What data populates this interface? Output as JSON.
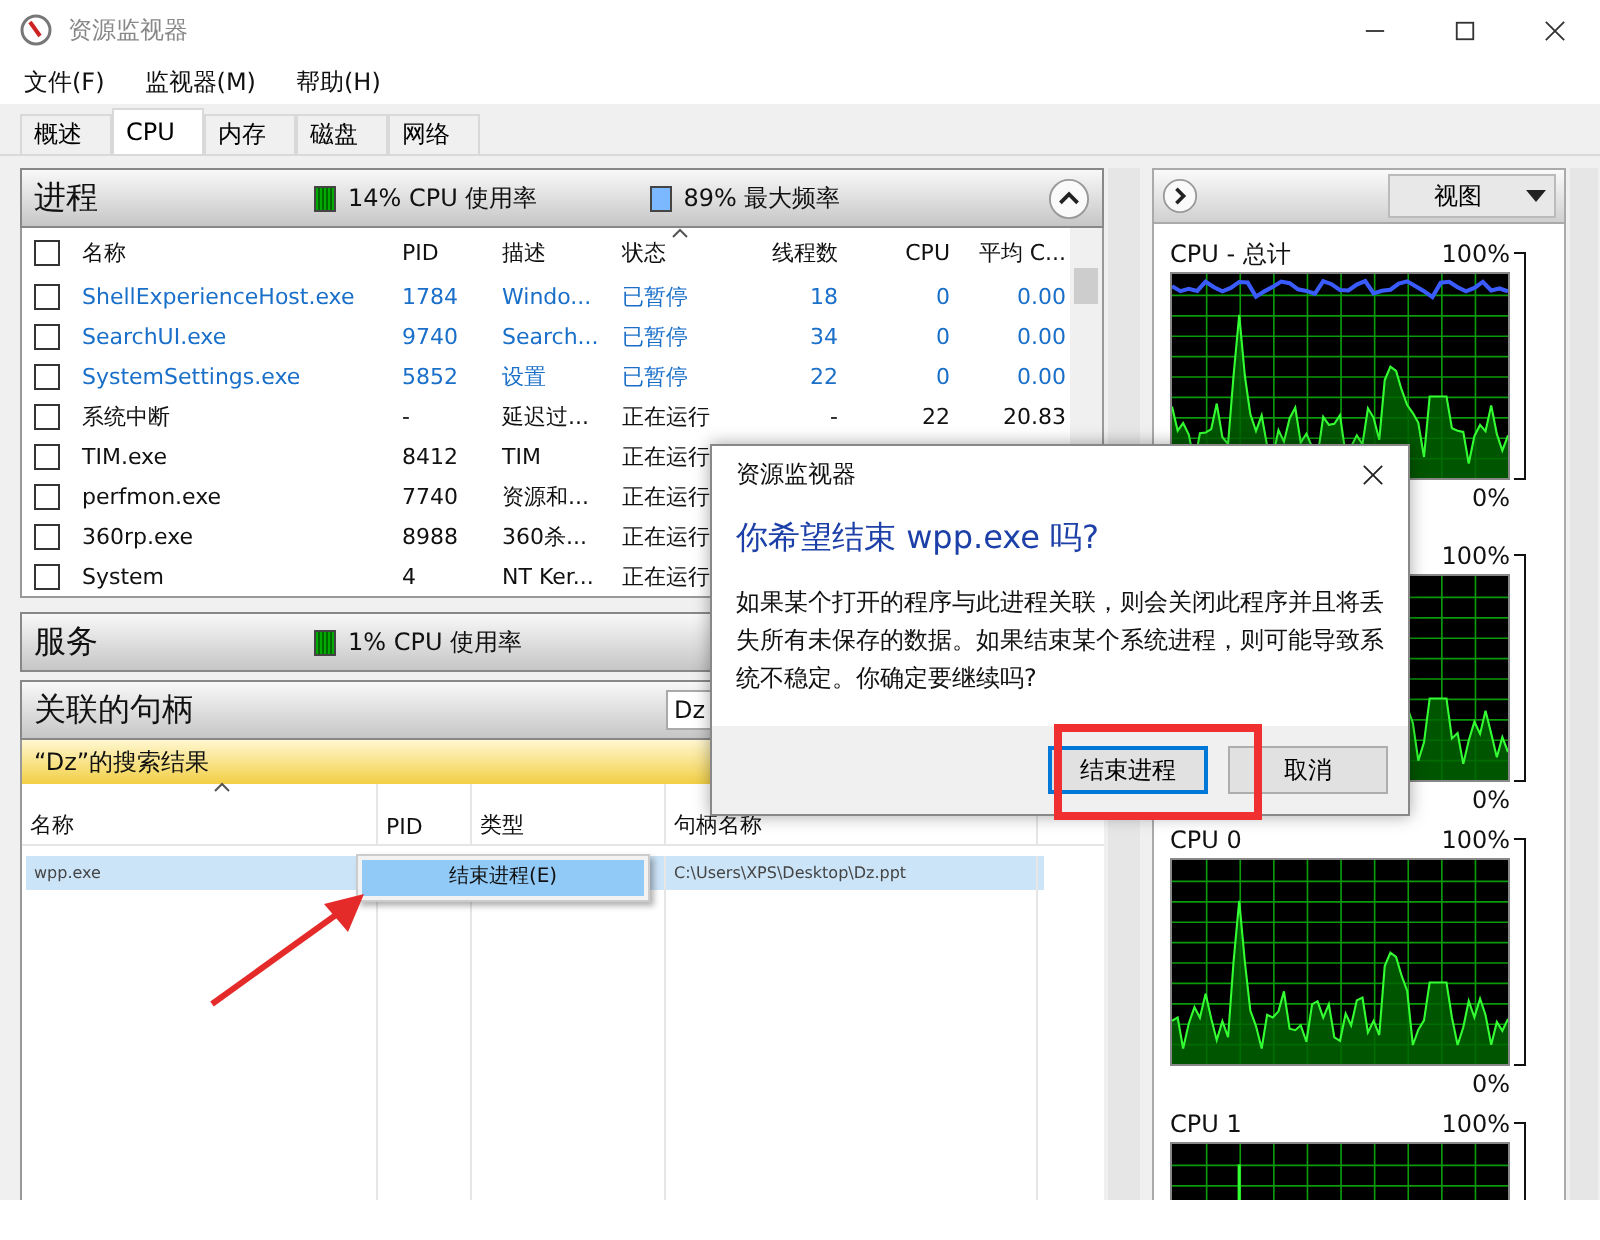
{
  "window": {
    "title": "资源监视器"
  },
  "menu": [
    "文件(F)",
    "监视器(M)",
    "帮助(H)"
  ],
  "tabs": [
    {
      "label": "概述",
      "selected": false
    },
    {
      "label": "CPU",
      "selected": true
    },
    {
      "label": "内存",
      "selected": false
    },
    {
      "label": "磁盘",
      "selected": false
    },
    {
      "label": "网络",
      "selected": false
    }
  ],
  "processes": {
    "title": "进程",
    "all_checked": false,
    "cpu_usage": "14% CPU 使用率",
    "max_frequency": "89% 最大频率",
    "columns": [
      "名称",
      "PID",
      "描述",
      "状态",
      "线程数",
      "CPU",
      "平均 C..."
    ],
    "rows": [
      {
        "checked": false,
        "suspended": true,
        "cells": [
          "ShellExperienceHost.exe",
          "1784",
          "Windo...",
          "已暂停",
          "18",
          "0",
          "0.00"
        ]
      },
      {
        "checked": false,
        "suspended": true,
        "cells": [
          "SearchUI.exe",
          "9740",
          "Search...",
          "已暂停",
          "34",
          "0",
          "0.00"
        ]
      },
      {
        "checked": false,
        "suspended": true,
        "cells": [
          "SystemSettings.exe",
          "5852",
          "设置",
          "已暂停",
          "22",
          "0",
          "0.00"
        ]
      },
      {
        "checked": false,
        "suspended": false,
        "cells": [
          "系统中断",
          "-",
          "延迟过...",
          "正在运行",
          "-",
          "22",
          "20.83"
        ]
      },
      {
        "checked": false,
        "suspended": false,
        "cells": [
          "TIM.exe",
          "8412",
          "TIM",
          "正在运行"
        ]
      },
      {
        "checked": false,
        "suspended": false,
        "cells": [
          "perfmon.exe",
          "7740",
          "资源和...",
          "正在运行"
        ]
      },
      {
        "checked": false,
        "suspended": false,
        "cells": [
          "360rp.exe",
          "8988",
          "360杀...",
          "正在运行"
        ]
      },
      {
        "checked": false,
        "suspended": false,
        "cells": [
          "System",
          "4",
          "NT Ker...",
          "正在运行"
        ]
      }
    ]
  },
  "services": {
    "title": "服务",
    "cpu_usage": "1% CPU 使用率"
  },
  "handles": {
    "title": "关联的句柄",
    "search_value": "Dz",
    "banner": "“Dz”的搜索结果",
    "columns": [
      "名称",
      "PID",
      "类型",
      "句柄名称"
    ],
    "rows": [
      {
        "name": "wpp.exe",
        "handle": "C:\\Users\\XPS\\Desktop\\Dz.ppt",
        "selected": true
      }
    ]
  },
  "context_menu": {
    "items": [
      {
        "label": "结束进程(E)",
        "selected": true
      }
    ]
  },
  "dialog": {
    "title": "资源监视器",
    "heading": "你希望结束 wpp.exe 吗?",
    "message": "如果某个打开的程序与此进程关联，则会关闭此程序并且将丢失所有未保存的数据。如果结束某个系统进程，则可能导致系统不稳定。你确定要继续吗?",
    "buttons": [
      {
        "label": "结束进程",
        "default": true
      },
      {
        "label": "取消",
        "default": false
      }
    ]
  },
  "graphs": {
    "view_button": "视图",
    "items": [
      {
        "label": "CPU - 总计",
        "max": "100%",
        "min": "0%",
        "frequency_line": true
      },
      {
        "max": "100%",
        "min": "0%",
        "frequency_line": false
      },
      {
        "label": "CPU 0",
        "max": "100%",
        "min": "0%",
        "frequency_line": false
      },
      {
        "label": "CPU 1",
        "max": "100%",
        "frequency_line": false
      }
    ]
  }
}
